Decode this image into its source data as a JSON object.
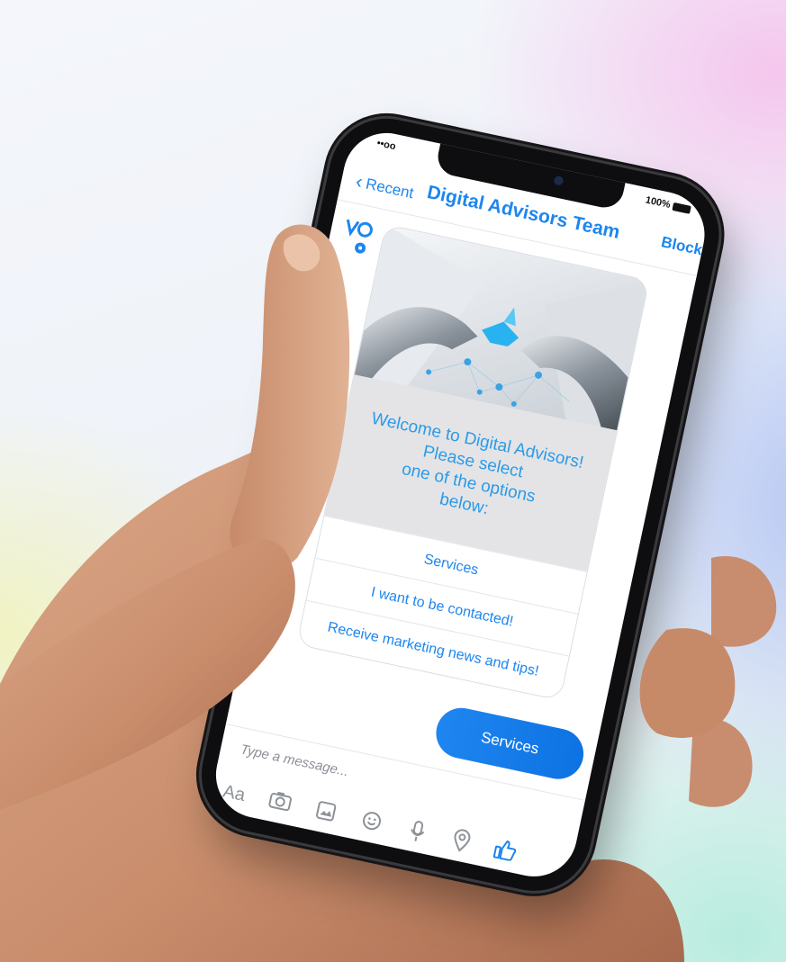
{
  "status_bar": {
    "signal": "••oo",
    "battery": "100%"
  },
  "header": {
    "back_label": "Recent",
    "title": "Digital Advisors Team",
    "block_label": "Block"
  },
  "card": {
    "message": "Welcome to Digital Advisors!\nPlease select\none of the options\nbelow:",
    "options": [
      {
        "label": "Services"
      },
      {
        "label": "I want to be contacted!"
      },
      {
        "label": "Receive marketing news and tips!"
      }
    ]
  },
  "sent_message": "Services",
  "composer": {
    "placeholder": "Type a message..."
  },
  "toolbar": {
    "aa_label": "Aa",
    "icons": [
      "camera-icon",
      "gallery-icon",
      "emoji-icon",
      "microphone-icon",
      "location-icon",
      "like-icon"
    ]
  },
  "colors": {
    "accent": "#1d86ee",
    "bubble": "#1f86f0",
    "message_text": "#2b9be8",
    "card_grey": "#e4e4e6"
  }
}
